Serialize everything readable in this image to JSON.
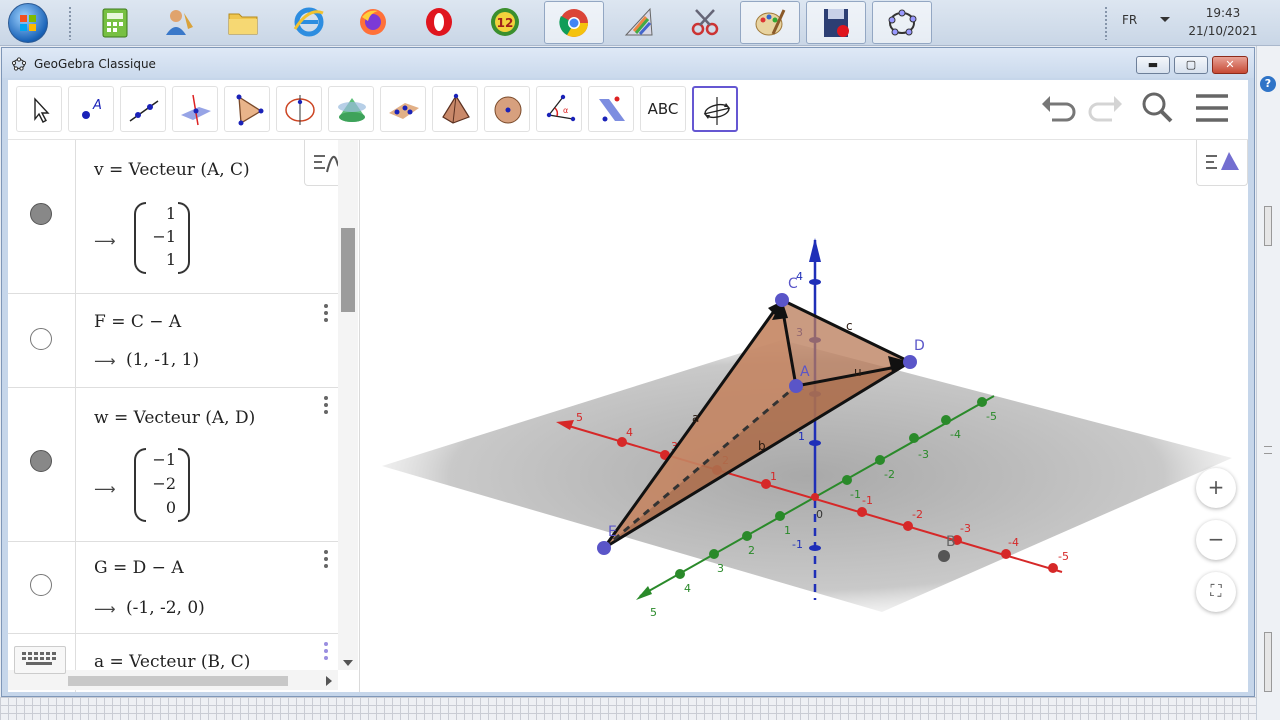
{
  "taskbar": {
    "language": "FR",
    "time": "19:43",
    "date": "21/10/2021",
    "apps": [
      {
        "name": "calculator-app-icon"
      },
      {
        "name": "user-settings-app-icon"
      },
      {
        "name": "file-explorer-icon"
      },
      {
        "name": "internet-explorer-icon"
      },
      {
        "name": "firefox-icon"
      },
      {
        "name": "opera-icon"
      },
      {
        "name": "app-12-icon",
        "badge": "12"
      },
      {
        "name": "chrome-icon"
      },
      {
        "name": "ruler-app-icon"
      },
      {
        "name": "snipping-tool-icon"
      },
      {
        "name": "paint-icon"
      },
      {
        "name": "screen-recorder-icon"
      },
      {
        "name": "geogebra-taskbar-icon"
      }
    ]
  },
  "window": {
    "title": "GeoGebra Classique",
    "min_label": "▬",
    "max_label": "▢",
    "close_label": "✕"
  },
  "toolbar": {
    "tools": [
      "move-tool",
      "point-tool",
      "line-tool",
      "perpendicular-tool",
      "polygon-tool",
      "circle-axis-tool",
      "cone-tool",
      "plane-points-tool",
      "pyramid-tool",
      "sphere-tool",
      "angle-tool",
      "reflect-tool",
      "text-tool",
      "rotate-view-tool"
    ],
    "text_tool_label": "ABC"
  },
  "algebra": {
    "items": [
      {
        "expr": "v = Vecteur (A, C)",
        "visible": true,
        "vector": [
          "1",
          "−1",
          "1"
        ]
      },
      {
        "expr": "F = C − A",
        "visible": false,
        "result": "(1, -1, 1)"
      },
      {
        "expr": "w = Vecteur (A, D)",
        "visible": true,
        "vector": [
          "−1",
          "−2",
          "0"
        ]
      },
      {
        "expr": "G = D − A",
        "visible": false,
        "result": "(-1, -2, 0)"
      },
      {
        "expr": "a = Vecteur (B, C)",
        "visible": true
      }
    ]
  },
  "view3d": {
    "point_labels": {
      "A": "A",
      "B": "B",
      "C": "C",
      "D": "D",
      "E": "E"
    },
    "edge_labels": {
      "a": "a",
      "b": "b",
      "c": "c",
      "u": "u"
    },
    "x_ticks": [
      "-5",
      "-4",
      "-3",
      "-2",
      "-1",
      "1",
      "2",
      "3",
      "4",
      "5"
    ],
    "y_ticks": [
      "-5",
      "-4",
      "-3",
      "-2",
      "-1",
      "1",
      "2",
      "3",
      "4",
      "5"
    ],
    "z_ticks": [
      "-1",
      "1",
      "2",
      "3",
      "4"
    ],
    "origin": "0",
    "zoom_in": "+",
    "zoom_out": "−",
    "fullscreen": "⛶"
  },
  "colors": {
    "x_axis": "#d62828",
    "y_axis": "#2a8a2a",
    "z_axis": "#1f2fb8",
    "points": "#5a55c8",
    "solid": "#b97a58",
    "accent": "#6557d2"
  }
}
